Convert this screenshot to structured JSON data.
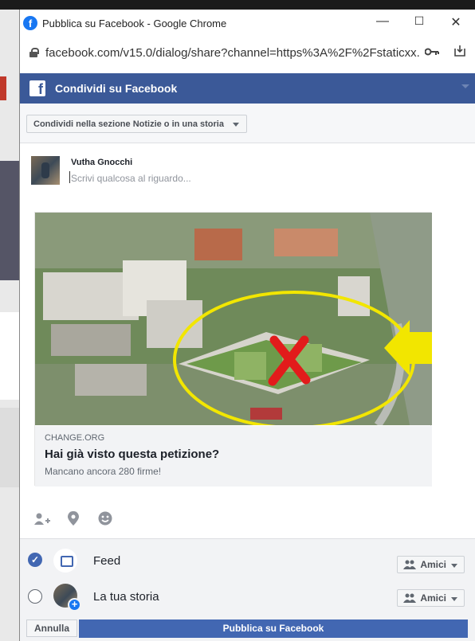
{
  "window": {
    "title": "Pubblica su Facebook - Google Chrome",
    "minimize": "—",
    "maximize": "☐",
    "close": "✕"
  },
  "browser": {
    "url": "facebook.com/v15.0/dialog/share?channel=https%3A%2F%2Fstaticxx.faceb..."
  },
  "dialog": {
    "header": "Condividi su Facebook",
    "share_target": "Condividi nella sezione Notizie o in una storia"
  },
  "composer": {
    "user_name": "Vutha Gnocchi",
    "placeholder": "Scrivi qualcosa al riguardo..."
  },
  "link_card": {
    "domain": "CHANGE.ORG",
    "title": "Hai già visto questa petizione?",
    "subtitle": "Mancano ancora 280 firme!"
  },
  "destinations": [
    {
      "label": "Feed",
      "audience": "Amici",
      "checked": true
    },
    {
      "label": "La tua storia",
      "audience": "Amici",
      "checked": false
    }
  ],
  "buttons": {
    "cancel": "Annulla",
    "publish": "Pubblica su Facebook"
  },
  "colors": {
    "facebook_blue": "#3b5998",
    "publish_blue": "#4267b2"
  }
}
